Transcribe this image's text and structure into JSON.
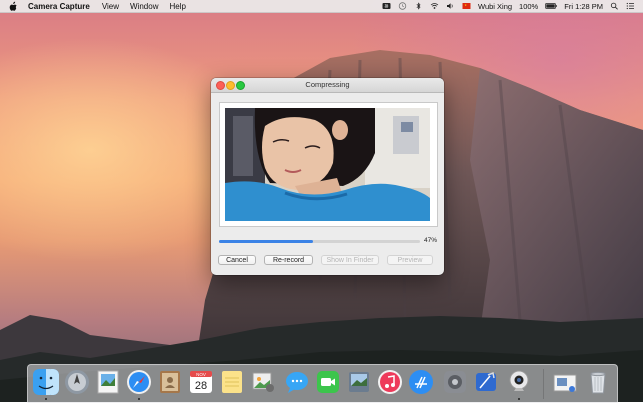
{
  "menubar": {
    "app_name": "Camera Capture",
    "menus": [
      "View",
      "Window",
      "Help"
    ],
    "input_source": "Wubi Xing",
    "battery": "100%",
    "clock": "Fri 1:28 PM"
  },
  "window": {
    "title": "Compressing",
    "progress_percent": 47,
    "progress_label": "47%",
    "buttons": {
      "cancel": "Cancel",
      "rerecord": "Re-record",
      "show_in_finder": "Show In Finder",
      "preview": "Preview"
    }
  },
  "dock": {
    "apps": [
      "finder-icon",
      "launchpad-icon",
      "preview-icon",
      "safari-icon",
      "contacts-icon",
      "calendar-icon",
      "notes-icon",
      "photos-icon",
      "messages-icon",
      "facetime-icon",
      "image-capture-icon",
      "itunes-icon",
      "app-store-icon",
      "system-preferences-icon",
      "xcode-icon",
      "camera-capture-icon"
    ],
    "calendar": {
      "month": "NOV",
      "day": "28"
    }
  }
}
